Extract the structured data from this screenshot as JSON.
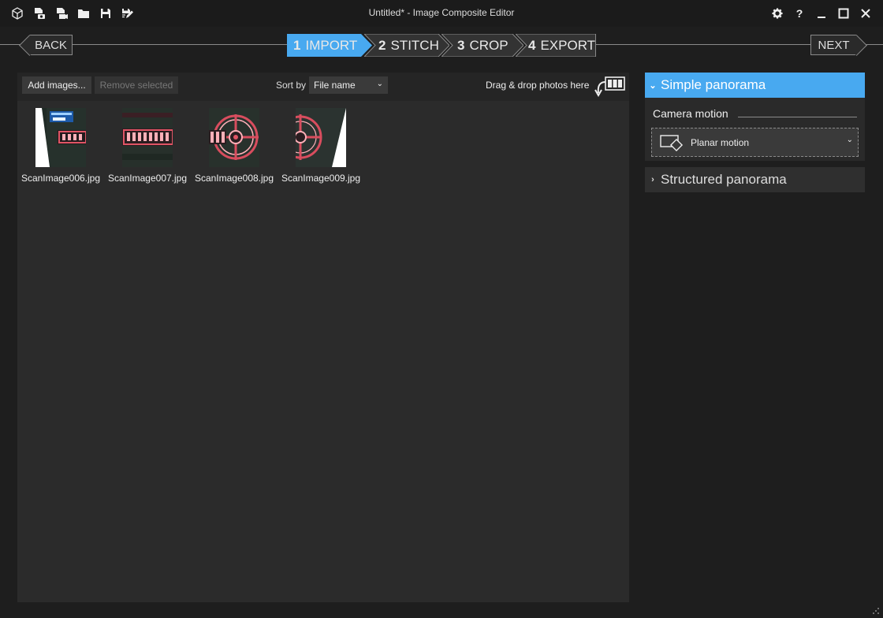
{
  "window": {
    "title": "Untitled* - Image Composite Editor",
    "help_label": "?"
  },
  "nav": {
    "back_label": "BACK",
    "next_label": "NEXT",
    "steps": [
      {
        "num": "1",
        "label": "IMPORT",
        "active": true
      },
      {
        "num": "2",
        "label": "STITCH",
        "active": false
      },
      {
        "num": "3",
        "label": "CROP",
        "active": false
      },
      {
        "num": "4",
        "label": "EXPORT",
        "active": false
      }
    ]
  },
  "toolbar": {
    "add_images": "Add images...",
    "remove_selected": "Remove selected",
    "sort_by_label": "Sort by",
    "sort_by_value": "File name",
    "drag_drop": "Drag & drop photos here"
  },
  "images": [
    {
      "filename": "ScanImage006.jpg"
    },
    {
      "filename": "ScanImage007.jpg"
    },
    {
      "filename": "ScanImage008.jpg"
    },
    {
      "filename": "ScanImage009.jpg"
    }
  ],
  "panel": {
    "simple_panorama": "Simple panorama",
    "camera_motion_label": "Camera motion",
    "camera_motion_value": "Planar motion",
    "structured_panorama": "Structured panorama"
  },
  "colors": {
    "accent": "#48a9f0",
    "background": "#1e1e1e",
    "panel": "#2b2b2b"
  }
}
